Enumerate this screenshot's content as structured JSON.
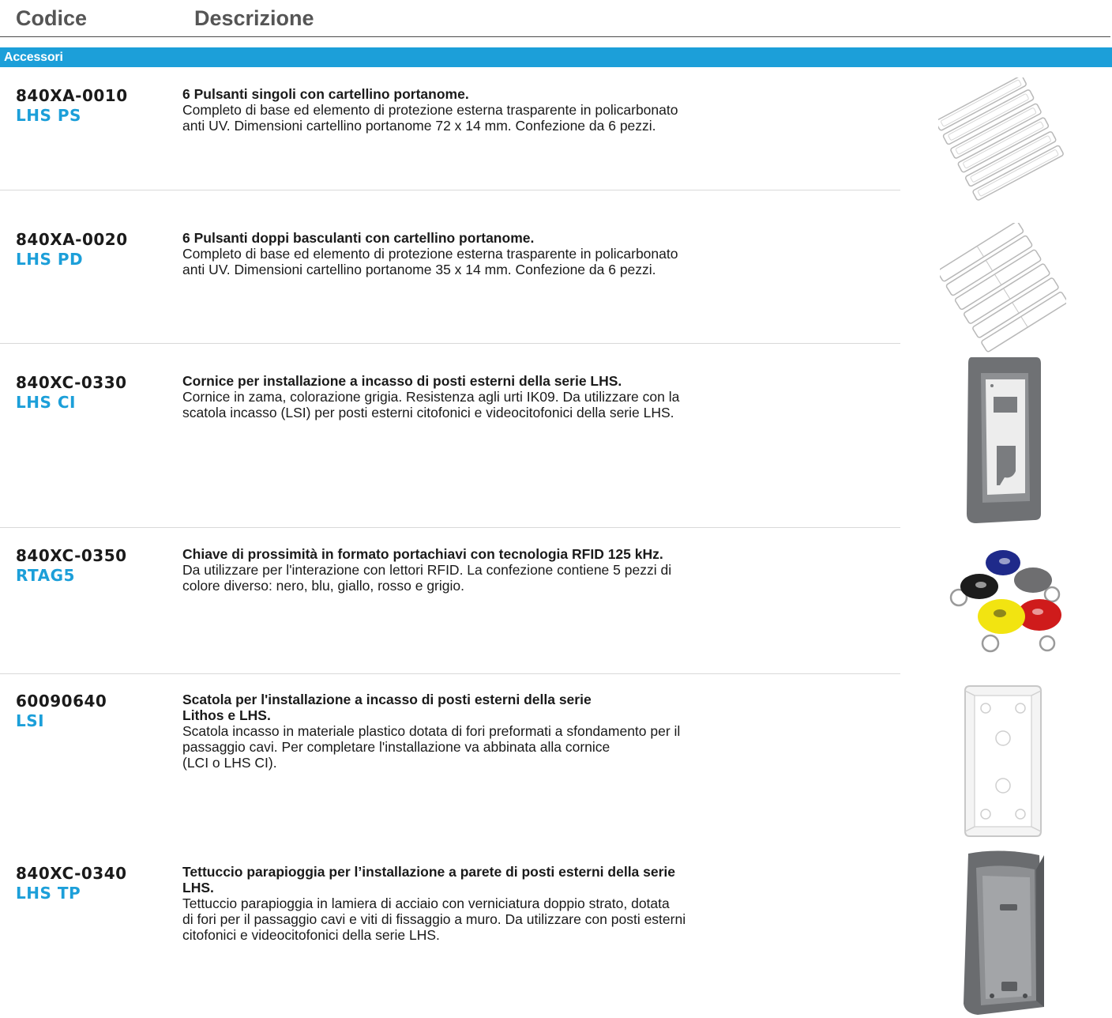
{
  "header": {
    "code_label": "Codice",
    "desc_label": "Descrizione"
  },
  "section": {
    "title": "Accessori"
  },
  "colors": {
    "accent": "#1c9fd9",
    "text": "#1a1a1a",
    "header_text": "#555555"
  },
  "items": [
    {
      "code": "840XA-0010",
      "model": "LHS PS",
      "title": "6 Pulsanti singoli con cartellino portanome.",
      "lines": [
        "Completo di base ed elemento di protezione esterna trasparente in policarbonato",
        "anti UV. Dimensioni cartellino portanome 72 x 14 mm. Confezione da 6 pezzi."
      ],
      "image": "single-buttons-icon"
    },
    {
      "code": "840XA-0020",
      "model": "LHS PD",
      "title": "6 Pulsanti doppi basculanti con cartellino portanome.",
      "lines": [
        "Completo di base ed elemento di protezione esterna trasparente in policarbonato",
        "anti UV. Dimensioni cartellino portanome 35 x 14 mm. Confezione da 6 pezzi."
      ],
      "image": "double-buttons-icon"
    },
    {
      "code": "840XC-0330",
      "model": "LHS CI",
      "title": "Cornice per installazione a incasso di posti esterni della serie LHS.",
      "lines": [
        "Cornice in zama, colorazione grigia. Resistenza agli urti IK09. Da utilizzare con la",
        "scatola incasso (LSI) per posti esterni citofonici e videocitofonici della serie LHS."
      ],
      "image": "flush-frame-icon"
    },
    {
      "code": "840XC-0350",
      "model": "RTAG5",
      "title": "Chiave di prossimità in formato portachiavi con tecnologia RFID 125 kHz.",
      "lines": [
        "Da utilizzare per l'interazione con lettori RFID. La confezione contiene 5 pezzi di",
        "colore diverso: nero, blu, giallo, rosso e grigio."
      ],
      "image": "rfid-keyfob-icon"
    },
    {
      "code": "60090640",
      "model": "LSI",
      "title_lines": [
        "Scatola per l'installazione a incasso di posti esterni della serie",
        "Lithos e LHS."
      ],
      "lines": [
        "Scatola incasso in materiale plastico dotata di fori preformati a sfondamento per il",
        "passaggio cavi. Per completare l'installazione va abbinata alla cornice",
        "(LCI o LHS CI)."
      ],
      "image": "flush-box-icon"
    },
    {
      "code": "840XC-0340",
      "model": "LHS TP",
      "title_lines": [
        "Tettuccio parapioggia per l’installazione a parete di posti esterni della serie",
        "LHS."
      ],
      "lines": [
        "Tettuccio parapioggia in lamiera di acciaio con verniciatura doppio strato, dotata",
        "di fori per il passaggio cavi e viti di fissaggio a muro. Da utilizzare con posti esterni",
        "citofonici e videocitofonici della serie LHS."
      ],
      "image": "rain-hood-icon"
    }
  ]
}
